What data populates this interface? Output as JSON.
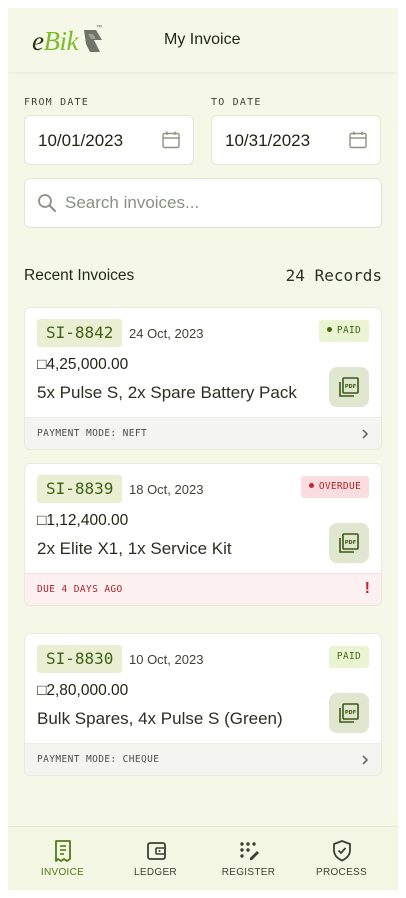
{
  "header": {
    "logo_e": "e",
    "logo_bik": "Bik",
    "logo_tm": "™",
    "title": "My Invoice"
  },
  "filters": {
    "from_label": "FROM DATE",
    "from_value": "10/01/2023",
    "to_label": "TO DATE",
    "to_value": "10/31/2023"
  },
  "search": {
    "placeholder": "Search invoices..."
  },
  "section": {
    "title": "Recent Invoices",
    "records": "24 Records"
  },
  "invoices": [
    {
      "id": "SI-8842",
      "date": "24 Oct, 2023",
      "status": "PAID",
      "amount": "□4,25,000.00",
      "items": "5x Pulse S, 2x Spare Battery Pack",
      "footer": "PAYMENT MODE: NEFT"
    },
    {
      "id": "SI-8839",
      "date": "18 Oct, 2023",
      "status": "OVERDUE",
      "amount": "□1,12,400.00",
      "items": "2x Elite X1, 1x Service Kit",
      "footer": "DUE 4 DAYS AGO",
      "footer_icon": "!"
    },
    {
      "id": "SI-8830",
      "date": "10 Oct, 2023",
      "status": "PAID",
      "amount": "□2,80,000.00",
      "items": "Bulk Spares, 4x Pulse S (Green)",
      "footer": "PAYMENT MODE: CHEQUE"
    }
  ],
  "nav": [
    {
      "label": "INVOICE",
      "icon": "invoice-icon",
      "active": true
    },
    {
      "label": "LEDGER",
      "icon": "wallet-icon",
      "active": false
    },
    {
      "label": "REGISTER",
      "icon": "register-icon",
      "active": false
    },
    {
      "label": "PROCESS",
      "icon": "shield-check-icon",
      "active": false
    }
  ],
  "colors": {
    "background": "#f5f8e7",
    "accent": "#4f7d14",
    "brand_green": "#7dbb2d",
    "paid": "#3e6a12",
    "overdue": "#c82333"
  }
}
